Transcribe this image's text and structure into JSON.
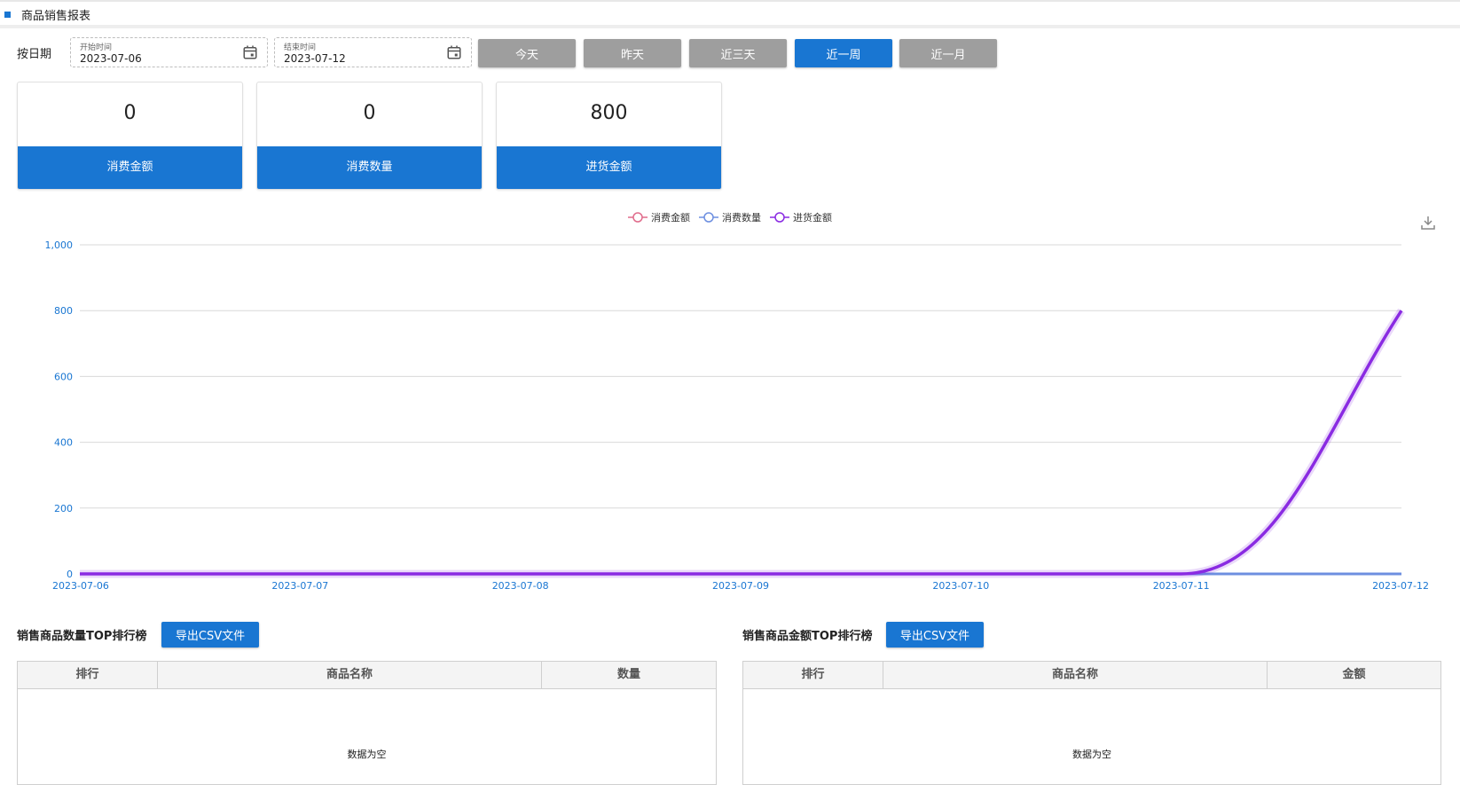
{
  "header": {
    "title": "商品销售报表"
  },
  "filter": {
    "label": "按日期",
    "start": {
      "label": "开始时间",
      "value": "2023-07-06"
    },
    "end": {
      "label": "结束时间",
      "value": "2023-07-12"
    },
    "ranges": [
      {
        "label": "今天",
        "active": false
      },
      {
        "label": "昨天",
        "active": false
      },
      {
        "label": "近三天",
        "active": false
      },
      {
        "label": "近一周",
        "active": true
      },
      {
        "label": "近一月",
        "active": false
      }
    ]
  },
  "cards": [
    {
      "value": "0",
      "label": "消费金额"
    },
    {
      "value": "0",
      "label": "消费数量"
    },
    {
      "value": "800",
      "label": "进货金额"
    }
  ],
  "chart_data": {
    "type": "line",
    "categories": [
      "2023-07-06",
      "2023-07-07",
      "2023-07-08",
      "2023-07-09",
      "2023-07-10",
      "2023-07-11",
      "2023-07-12"
    ],
    "series": [
      {
        "name": "消费金额",
        "values": [
          0,
          0,
          0,
          0,
          0,
          0,
          0
        ],
        "color": "#e06c8c"
      },
      {
        "name": "消费数量",
        "values": [
          0,
          0,
          0,
          0,
          0,
          0,
          0
        ],
        "color": "#6d8fe0"
      },
      {
        "name": "进货金额",
        "values": [
          0,
          0,
          0,
          0,
          0,
          0,
          800
        ],
        "color": "#8a2be2"
      }
    ],
    "ylim": [
      0,
      1000
    ],
    "yticks": [
      0,
      200,
      400,
      600,
      800,
      1000
    ],
    "ytick_labels": [
      "0",
      "200",
      "400",
      "600",
      "800",
      "1,000"
    ],
    "legend_position": "top-center",
    "grid": true,
    "smooth": true
  },
  "tables": [
    {
      "title": "销售商品数量TOP排行榜",
      "export_label": "导出CSV文件",
      "columns": [
        "排行",
        "商品名称",
        "数量"
      ],
      "empty_text": "数据为空"
    },
    {
      "title": "销售商品金额TOP排行榜",
      "export_label": "导出CSV文件",
      "columns": [
        "排行",
        "商品名称",
        "金额"
      ],
      "empty_text": "数据为空"
    }
  ],
  "icons": {
    "calendar": "calendar-icon",
    "download": "download-icon"
  }
}
